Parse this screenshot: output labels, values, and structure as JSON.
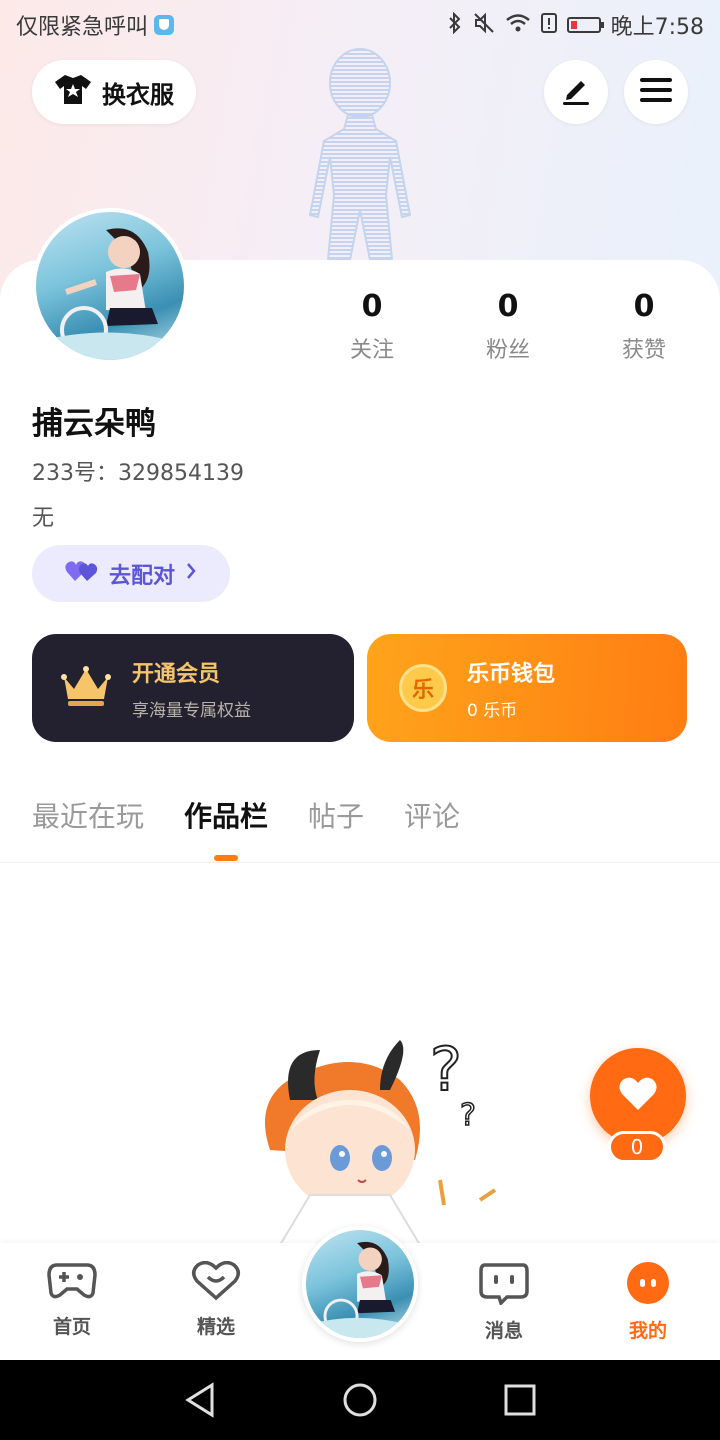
{
  "status_bar": {
    "carrier": "仅限紧急呼叫",
    "time": "晚上7:58"
  },
  "header": {
    "outfit_label": "换衣服"
  },
  "profile": {
    "username": "捕云朵鸭",
    "uid": "233号：329854139",
    "bio": "无",
    "stats": [
      {
        "value": "0",
        "label": "关注"
      },
      {
        "value": "0",
        "label": "粉丝"
      },
      {
        "value": "0",
        "label": "获赞"
      }
    ],
    "pair_label": "去配对"
  },
  "cards": {
    "vip": {
      "title": "开通会员",
      "subtitle": "享海量专属权益"
    },
    "wallet": {
      "title": "乐币钱包",
      "subtitle": "0 乐币",
      "coin_glyph": "乐"
    }
  },
  "tabs": [
    {
      "label": "最近在玩"
    },
    {
      "label": "作品栏"
    },
    {
      "label": "帖子"
    },
    {
      "label": "评论"
    }
  ],
  "like": {
    "count": "0"
  },
  "bottom_nav": [
    {
      "label": "首页"
    },
    {
      "label": "精选"
    },
    {
      "label": "消息"
    },
    {
      "label": "我的"
    }
  ],
  "colors": {
    "accent": "#ff7d12",
    "vip_gold": "#f5c46b",
    "pair_purple": "#5d55d8"
  }
}
